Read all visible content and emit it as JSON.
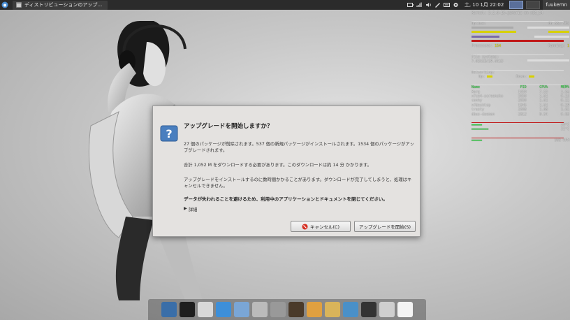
{
  "panel": {
    "task_title": "ディストリビューションのアップ…",
    "clock": "土, 10  1月  22:02",
    "username": "fuukemn"
  },
  "conky": {
    "kernel": "Kernel: 3.2.0-16-generic on x86_64",
    "uptime_label": "Uptime:",
    "uptime_value": "0h 33m 50s",
    "processes_label": "Processes:",
    "processes_value": "154",
    "running_label": "Running:",
    "running_value": "1",
    "fs_title": "File systems:",
    "fs_value": "7.02GiB/39.6GiB",
    "net_title": "Networking:",
    "net_up": "Up:",
    "net_down": "Down:",
    "proc_header": {
      "name": "Name",
      "pid": "PID",
      "cpu": "CPU%",
      "mem": "MEM%"
    },
    "procs": [
      {
        "name": "Xorg",
        "pid": "1059",
        "cpu": "7.53",
        "mem": "1.64"
      },
      {
        "name": "xfce4-screensho",
        "pid": "3050",
        "cpu": "1.61",
        "mem": "0.25"
      },
      {
        "name": "conky",
        "pid": "2050",
        "cpu": "1.61",
        "mem": "0.11"
      },
      {
        "name": "xfdesktop",
        "pid": "1845",
        "cpu": "1.61",
        "mem": "0.29"
      },
      {
        "name": "trusty",
        "pid": "2608",
        "cpu": "1.08",
        "mem": "1.61"
      },
      {
        "name": "dbus-daemon",
        "pid": "2812",
        "cpu": "0.54",
        "mem": "0.05"
      }
    ],
    "temp1": "58°C",
    "temp2": "32°C",
    "fan": "568 RPM"
  },
  "dialog": {
    "title": "アップグレードを開始しますか？",
    "para1": "27 個のパッケージが削除されます。537 個の新規パッケージがインストールされます。1534 個のパッケージがアップグレードされます。",
    "para2": "合計 1,052 M をダウンロードする必要があります。このダウンロードは約 14 分 かかります。",
    "para3": "アップグレードをインストールするのに数時間かかることがあります。ダウンロードが完了してしまうと、処理はキャンセルできません。",
    "warning": "データが失われることを避けるため、利用中のアプリケーションとドキュメントを閉じてください。",
    "details": "詳細",
    "cancel": "キャンセル(C)",
    "upgrade": "アップグレードを開始(S)"
  },
  "dock_items": [
    "desktop",
    "terminal",
    "file-manager",
    "browser",
    "mail",
    "mixer",
    "search",
    "media",
    "paint",
    "folder",
    "settings",
    "music",
    "trash",
    "chrome"
  ]
}
